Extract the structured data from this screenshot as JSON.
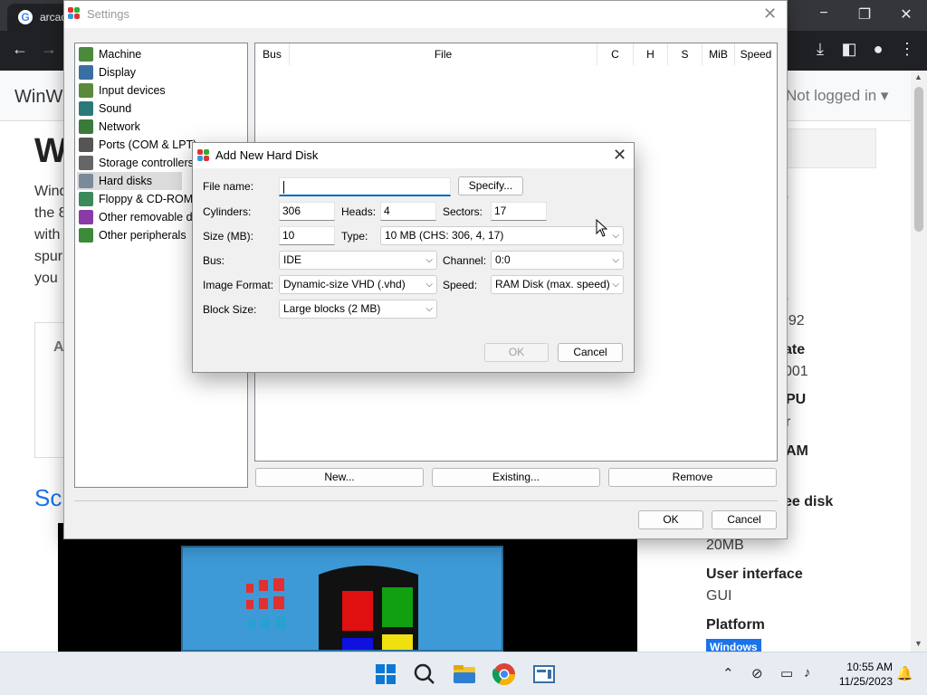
{
  "browser": {
    "tab_title": "arcad",
    "site_name": "WinW",
    "login_text": "Not logged in ▾",
    "page_title": "W",
    "page_text": "Wind\nthe 8\nwith\nspur\nyou",
    "card_label": "A",
    "section_title": "Sc",
    "facts": [
      {
        "label": "e",
        "value": ""
      },
      {
        "label": "e",
        "value": "992"
      },
      {
        "label": "ate",
        "value": "001"
      },
      {
        "label": "PU",
        "value": "r"
      },
      {
        "label": "AM",
        "value": ""
      },
      {
        "label": "ee disk",
        "value": "20MB"
      },
      {
        "label": "User interface",
        "value": "GUI"
      },
      {
        "label": "Platform",
        "value": ""
      }
    ],
    "platform_badge": "Windows"
  },
  "settings": {
    "title": "Settings",
    "categories": [
      {
        "label": "Machine",
        "icon": "machine-icon",
        "color": "#4a8a3a"
      },
      {
        "label": "Display",
        "icon": "display-icon",
        "color": "#3a6ea5"
      },
      {
        "label": "Input devices",
        "icon": "input-devices-icon",
        "color": "#5a8a3a"
      },
      {
        "label": "Sound",
        "icon": "sound-icon",
        "color": "#2a7a7a"
      },
      {
        "label": "Network",
        "icon": "network-icon",
        "color": "#3a7a3a"
      },
      {
        "label": "Ports (COM & LPT)",
        "icon": "ports-icon",
        "color": "#555555"
      },
      {
        "label": "Storage controllers",
        "icon": "storage-controllers-icon",
        "color": "#666666"
      },
      {
        "label": "Hard disks",
        "icon": "hard-disks-icon",
        "color": "#7a8a9a"
      },
      {
        "label": "Floppy & CD-ROM drives",
        "icon": "floppy-cdrom-icon",
        "color": "#3a8a5a"
      },
      {
        "label": "Other removable devices",
        "icon": "removable-devices-icon",
        "color": "#8a3aa5"
      },
      {
        "label": "Other peripherals",
        "icon": "peripherals-icon",
        "color": "#3a8a3a"
      }
    ],
    "selected_category": "Hard disks",
    "columns": [
      "Bus",
      "File",
      "C",
      "H",
      "S",
      "MiB",
      "Speed"
    ],
    "buttons": {
      "new": "New...",
      "existing": "Existing...",
      "remove": "Remove",
      "ok": "OK",
      "cancel": "Cancel"
    }
  },
  "dialog": {
    "title": "Add New Hard Disk",
    "file_name_label": "File name:",
    "file_name_value": "",
    "specify_button": "Specify...",
    "cylinders_label": "Cylinders:",
    "cylinders_value": "306",
    "heads_label": "Heads:",
    "heads_value": "4",
    "sectors_label": "Sectors:",
    "sectors_value": "17",
    "size_label": "Size (MB):",
    "size_value": "10",
    "type_label": "Type:",
    "type_value": "10 MB (CHS: 306, 4, 17)",
    "bus_label": "Bus:",
    "bus_value": "IDE",
    "channel_label": "Channel:",
    "channel_value": "0:0",
    "image_format_label": "Image Format:",
    "image_format_value": "Dynamic-size VHD (.vhd)",
    "speed_label": "Speed:",
    "speed_value": "RAM Disk (max. speed)",
    "block_size_label": "Block Size:",
    "block_size_value": "Large blocks (2 MB)",
    "ok_button": "OK",
    "cancel_button": "Cancel"
  },
  "taskbar": {
    "time": "10:55 AM",
    "date": "11/25/2023",
    "apps": [
      "start-icon",
      "search-icon",
      "file-explorer-icon",
      "chrome-icon",
      "86box-icon"
    ]
  },
  "colors": {
    "accent": "#0067c0",
    "selected": "#dcdcdc",
    "browser_dark": "#202124"
  }
}
